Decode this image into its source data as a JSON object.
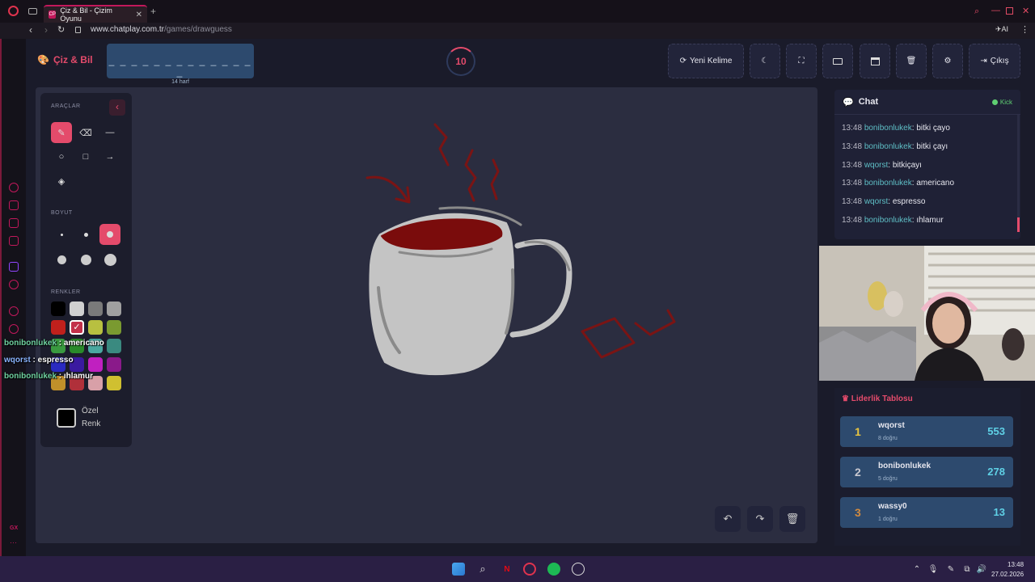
{
  "browser": {
    "tab_title": "Çiz & Bil - Çizim Oyunu",
    "tab_favicon": "CP",
    "url_domain": "www.chatplay.com.tr",
    "url_path": "/games/drawguess",
    "ai_label": "AI"
  },
  "app": {
    "logo": "Çiz & Bil",
    "word_dashes": "_ _ _ _ _ _ _ _ _ _ _ _ _ _",
    "word_hint": "14 harf",
    "timer": "10",
    "new_word_label": "Yeni Kelime",
    "exit_label": "Çıkış"
  },
  "tools": {
    "section_tools": "ARAÇLAR",
    "section_size": "BOYUT",
    "section_colors": "RENKLER",
    "custom_color_line1": "Özel",
    "custom_color_line2": "Renk",
    "palette": [
      "#000000",
      "#d0d0d0",
      "#7a7a7a",
      "#a0a0a0",
      "#c0201c",
      "#c2304a",
      "#b8c040",
      "#7a9a30",
      "#3a9a40",
      "#2a8a2a",
      "#4aa8a0",
      "#3a8a80",
      "#2a2ac0",
      "#3a1aa0",
      "#c020c0",
      "#8a1a8a",
      "#c0902a",
      "#b0303a",
      "#d8a0a8",
      "#d0c030"
    ]
  },
  "overlay_chat": [
    {
      "user": "bonibonlukek",
      "text": "americano"
    },
    {
      "user": "wqorst",
      "text": "espresso"
    },
    {
      "user": "bonibonlukek",
      "text": "ıhlamur"
    }
  ],
  "chat": {
    "title": "Chat",
    "platform": "Kick",
    "messages": [
      {
        "time": "13:48",
        "user": "bonibonlukek",
        "text": "bitki çayo"
      },
      {
        "time": "13:48",
        "user": "bonibonlukek",
        "text": "bitki çayı"
      },
      {
        "time": "13:48",
        "user": "wqorst",
        "text": "bitkiçayı"
      },
      {
        "time": "13:48",
        "user": "bonibonlukek",
        "text": "americano"
      },
      {
        "time": "13:48",
        "user": "wqorst",
        "text": "espresso"
      },
      {
        "time": "13:48",
        "user": "bonibonlukek",
        "text": "ıhlamur"
      }
    ]
  },
  "leaderboard": {
    "title": "Liderlik Tablosu",
    "rows": [
      {
        "rank": "1",
        "name": "wqorst",
        "sub": "8 doğru",
        "score": "553",
        "rank_color": "#e8c440"
      },
      {
        "rank": "2",
        "name": "bonibonlukek",
        "sub": "5 doğru",
        "score": "278",
        "rank_color": "#c8c8d0"
      },
      {
        "rank": "3",
        "name": "wassy0",
        "sub": "1 doğru",
        "score": "13",
        "rank_color": "#d08a40"
      }
    ]
  },
  "taskbar": {
    "time": "13:48",
    "date": "27.02.2026"
  },
  "icons": [
    "palette-icon",
    "pen-icon",
    "eraser-icon",
    "line-icon",
    "circle-icon",
    "square-icon",
    "arrow-icon",
    "fill-icon",
    "undo-icon",
    "redo-icon",
    "trash-icon",
    "moon-icon",
    "fullscreen-icon",
    "keyboard-icon",
    "archive-icon",
    "gear-icon",
    "exit-icon",
    "chat-icon",
    "crown-icon"
  ]
}
